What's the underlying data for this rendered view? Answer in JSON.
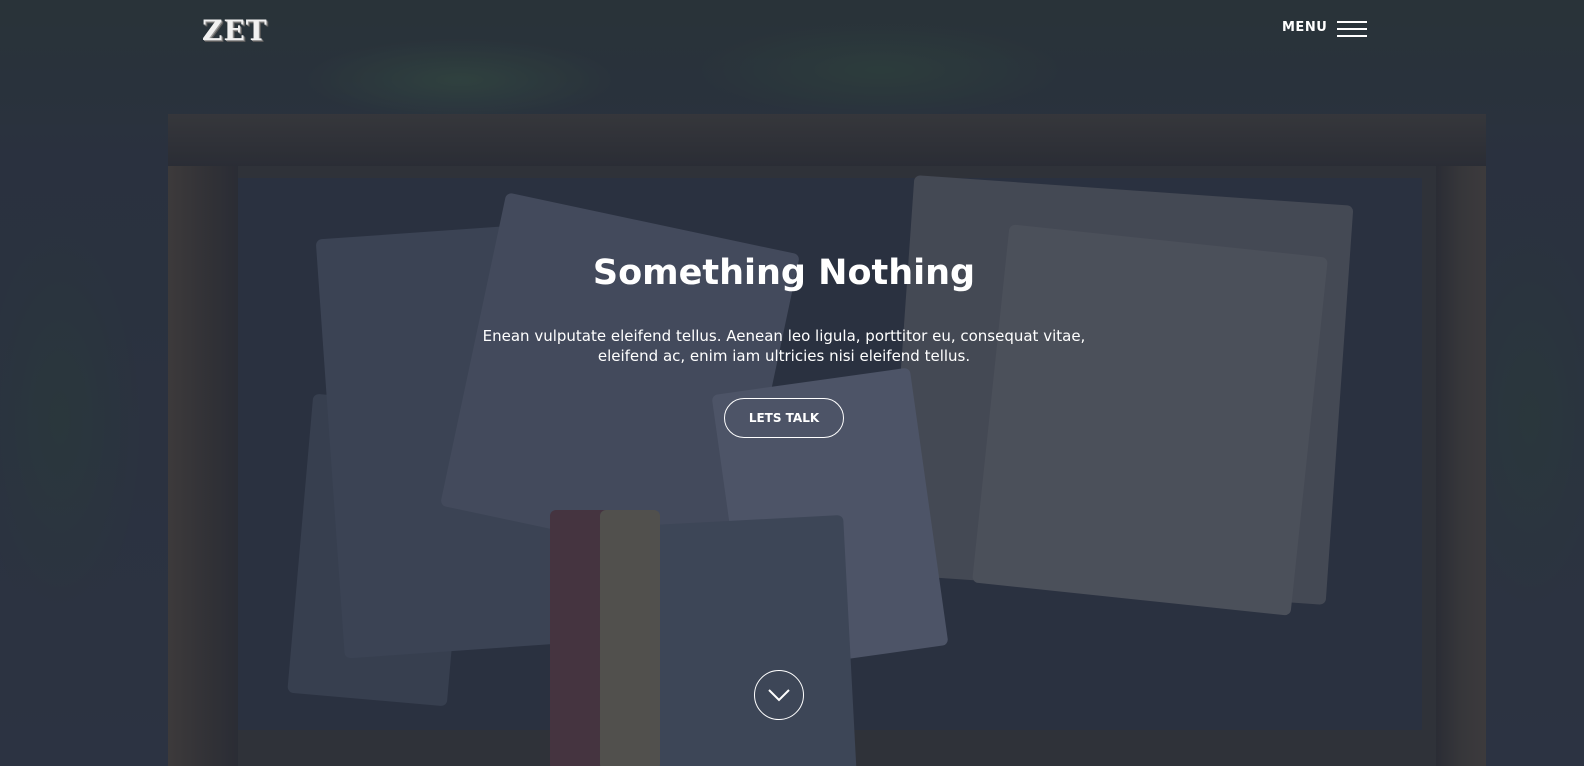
{
  "header": {
    "logo_text": "ZET",
    "menu_label": "MENU"
  },
  "hero": {
    "title": "Something Nothing",
    "subtitle": "Enean vulputate eleifend tellus. Aenean leo ligula, porttitor eu, consequat vitae, eleifend ac, enim iam ultricies nisi eleifend tellus.",
    "cta_label": "LETS TALK"
  },
  "icons": {
    "menu": "hamburger-icon",
    "scroll": "chevron-down-icon"
  },
  "colors": {
    "overlay": "#2e3444",
    "text": "#ffffff"
  }
}
